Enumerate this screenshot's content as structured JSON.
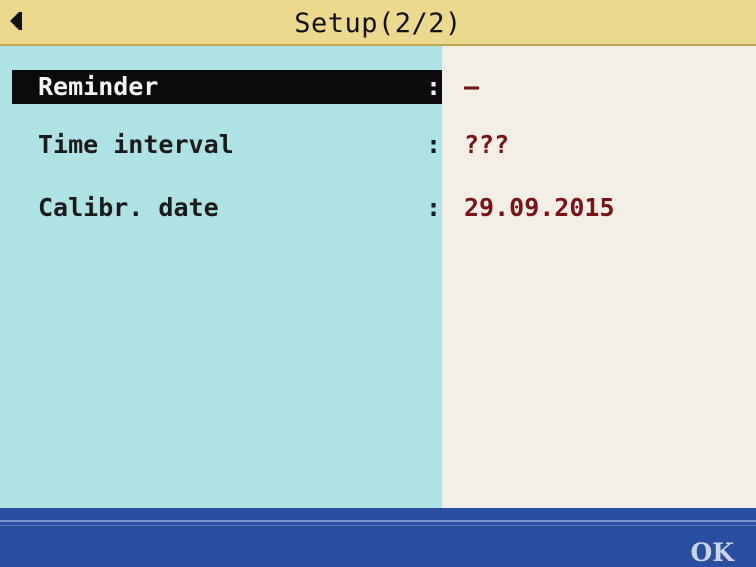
{
  "header": {
    "title": "Setup(2/2)",
    "back_icon": "triangle-left-icon"
  },
  "settings": [
    {
      "label": "Reminder",
      "value": "–",
      "selected": true
    },
    {
      "label": "Time interval",
      "value": "???",
      "selected": false
    },
    {
      "label": "Calibr. date",
      "value": "29.09.2015",
      "selected": false
    }
  ],
  "separator": ":",
  "footer": {
    "ok_label": "OK"
  },
  "colors": {
    "title_bg": "#ecd98e",
    "label_bg": "#aee2e3",
    "value_bg": "#f3efe7",
    "value_text": "#7a1216",
    "footer_bg": "#2a4fa0",
    "selection_bg": "#0b0b0b"
  }
}
